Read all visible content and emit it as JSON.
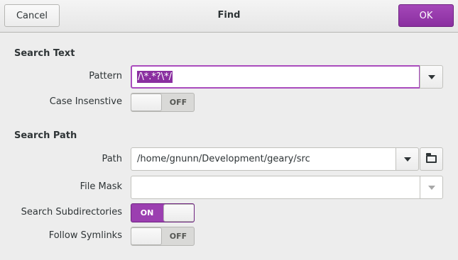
{
  "dialog": {
    "title": "Find",
    "cancel_label": "Cancel",
    "ok_label": "OK"
  },
  "search_text": {
    "heading": "Search Text",
    "pattern_label": "Pattern",
    "pattern_value": "/\\*.*?\\*/",
    "case_label": "Case Insenstive",
    "case_state": "OFF"
  },
  "search_path": {
    "heading": "Search Path",
    "path_label": "Path",
    "path_value": "/home/gnunn/Development/geary/src",
    "filemask_label": "File Mask",
    "filemask_value": "",
    "subdirs_label": "Search Subdirectories",
    "subdirs_state": "ON",
    "symlinks_label": "Follow Symlinks",
    "symlinks_state": "OFF"
  },
  "icons": {
    "dropdown": "chevron-down-icon",
    "folder": "folder-icon"
  },
  "colors": {
    "accent": "#9b3fb0",
    "background": "#ededed"
  }
}
